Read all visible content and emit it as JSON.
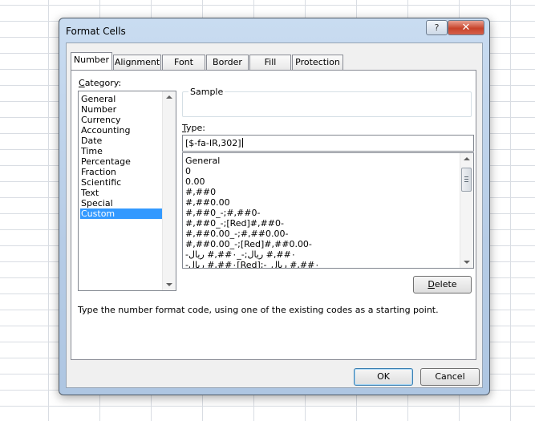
{
  "window": {
    "title": "Format Cells",
    "help_label": "?",
    "close_label": "✕"
  },
  "tabs": [
    "Number",
    "Alignment",
    "Font",
    "Border",
    "Fill",
    "Protection"
  ],
  "category": {
    "label_prefix": "C",
    "label_rest": "ategory:",
    "items": [
      "General",
      "Number",
      "Currency",
      "Accounting",
      "Date",
      "Time",
      "Percentage",
      "Fraction",
      "Scientific",
      "Text",
      "Special",
      "Custom"
    ],
    "selected": "Custom"
  },
  "sample": {
    "label": "Sample",
    "value": ""
  },
  "type": {
    "label_prefix": "T",
    "label_rest": "ype:",
    "value": "[$-fa-IR,302]",
    "formats": [
      "General",
      "0",
      "0.00",
      "#,##0",
      "#,##0.00",
      "#,##0_-;#,##0-",
      "#,##0_-;[Red]#,##0-",
      "#,##0.00_-;#,##0.00-",
      "#,##0.00_-;[Red]#,##0.00-",
      "-٠##,# ريال;-_٠##,# ريال",
      "-٠##,# ريال[Red];-_٠##,# ريال"
    ]
  },
  "buttons": {
    "delete_prefix": "D",
    "delete_rest": "elete",
    "ok": "OK",
    "cancel": "Cancel"
  },
  "hint": "Type the number format code, using one of the existing codes as a starting point.",
  "icons": {
    "help": "help-icon",
    "close": "close-icon",
    "scroll_up": "scroll-up-arrow-icon",
    "scroll_down": "scroll-down-arrow-icon"
  },
  "colors": {
    "selection": "#3399ff",
    "close_button": "#c7432a",
    "frame": "#b6cce6"
  }
}
